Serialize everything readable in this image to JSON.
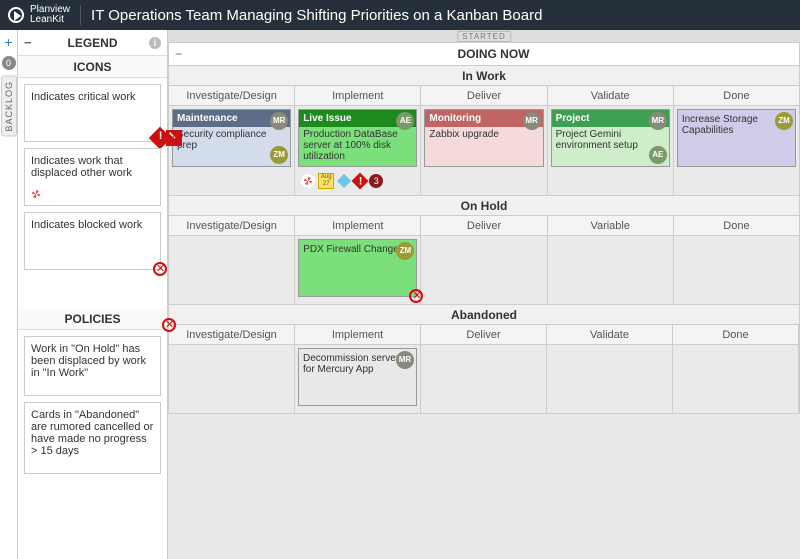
{
  "header": {
    "brand_line1": "Planview",
    "brand_line2": "LeanKit",
    "board_title": "IT Operations Team Managing Shifting Priorities on a Kanban Board"
  },
  "rail": {
    "backlog_label": "BACKLOG",
    "backlog_count": "0"
  },
  "legend": {
    "title": "LEGEND",
    "icons_heading": "ICONS",
    "policies_heading": "POLICIES",
    "icon_cards": [
      {
        "text": "Indicates critical work",
        "icon": "critical"
      },
      {
        "text": "Indicates work that displaced other work",
        "icon": "lifebuoy"
      },
      {
        "text": "Indicates blocked work",
        "icon": "blocked"
      }
    ],
    "policy_cards": [
      {
        "text": "Work in \"On Hold\" has been displaced by work in \"In Work\""
      },
      {
        "text": "Cards in \"Abandoned\" are rumored cancelled or have made no progress > 15 days"
      }
    ]
  },
  "board": {
    "started_label": "STARTED",
    "lane_title": "DOING NOW",
    "swimlanes": [
      {
        "title": "In Work",
        "columns": [
          "Investigate/Design",
          "Implement",
          "Deliver",
          "Validate",
          "Done"
        ],
        "cards": {
          "0": [
            {
              "type": "maint",
              "title": "Maintenance",
              "desc": "Security compliance prep",
              "avatars": [
                {
                  "ini": "MR",
                  "cls": "mr",
                  "pos": "tr"
                },
                {
                  "ini": "ZM",
                  "cls": "zm",
                  "pos": "br"
                }
              ],
              "critical": true
            }
          ],
          "1": [
            {
              "type": "live",
              "title": "Live Issue",
              "desc": "Production DataBase server at 100% disk utilization",
              "avatars": [
                {
                  "ini": "AE",
                  "cls": "ae",
                  "pos": "tr"
                }
              ],
              "attachments": true
            }
          ],
          "2": [
            {
              "type": "mon",
              "title": "Monitoring",
              "desc": "Zabbix upgrade",
              "avatars": [
                {
                  "ini": "MR",
                  "cls": "mr",
                  "pos": "tr"
                }
              ]
            }
          ],
          "3": [
            {
              "type": "proj",
              "title": "Project",
              "desc": "Project Gemini environment setup",
              "avatars": [
                {
                  "ini": "MR",
                  "cls": "mr",
                  "pos": "tr"
                },
                {
                  "ini": "AE",
                  "cls": "ae",
                  "pos": "br"
                }
              ]
            }
          ],
          "4": [
            {
              "type": "purple",
              "title": "",
              "desc": "Increase Storage Capabilities",
              "avatars": [
                {
                  "ini": "ZM",
                  "cls": "zm",
                  "pos": "tr"
                }
              ]
            }
          ]
        },
        "attachment_count": "3",
        "cal_month": "Aug",
        "cal_day": "27"
      },
      {
        "title": "On Hold",
        "columns": [
          "Investigate/Design",
          "Implement",
          "Deliver",
          "Variable",
          "Done"
        ],
        "cards": {
          "1": [
            {
              "type": "green",
              "title": "",
              "desc": "PDX Firewall Change",
              "avatars": [
                {
                  "ini": "ZM",
                  "cls": "zm",
                  "pos": "tr"
                }
              ],
              "blocked": true
            }
          ]
        }
      },
      {
        "title": "Abandoned",
        "columns": [
          "Investigate/Design",
          "Implement",
          "Deliver",
          "Validate",
          "Done"
        ],
        "cards": {
          "1": [
            {
              "type": "gray",
              "title": "",
              "desc": "Decommission servers for Mercury App",
              "avatars": [
                {
                  "ini": "MR",
                  "cls": "mr",
                  "pos": "tr"
                }
              ]
            }
          ]
        },
        "blocked_left": true
      }
    ]
  }
}
